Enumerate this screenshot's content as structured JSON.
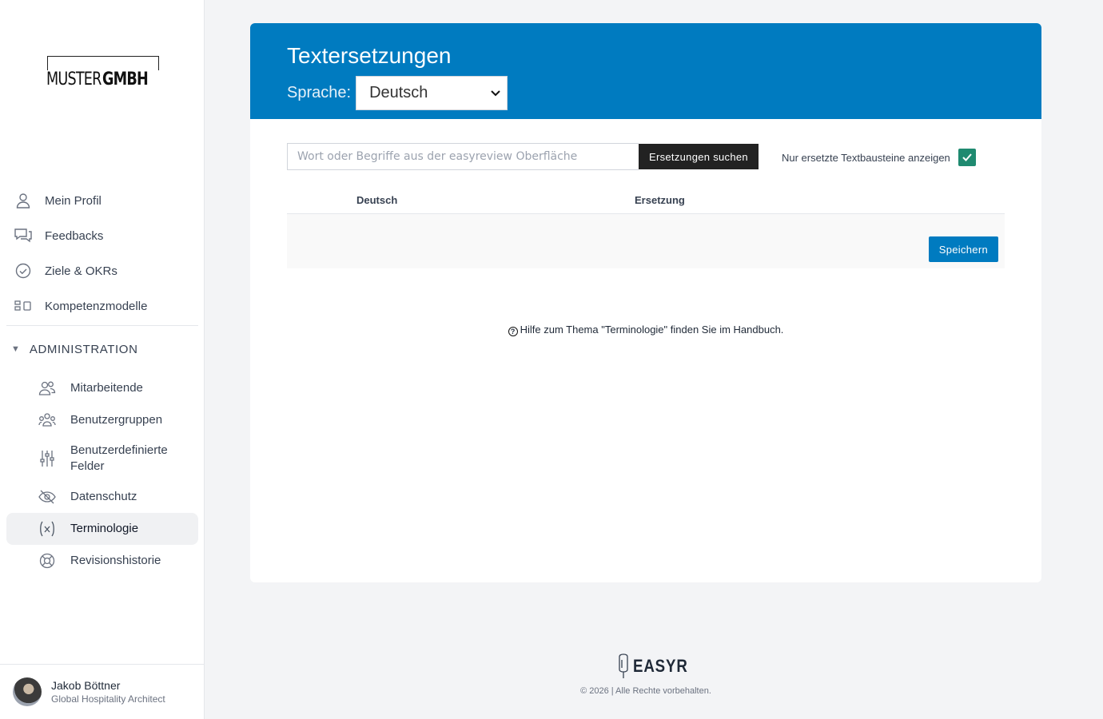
{
  "brand": {
    "logo_light": "MUSTER",
    "logo_bold": "GMBH"
  },
  "sidebar": {
    "items": [
      {
        "label": "Mein Profil",
        "icon": "user-icon"
      },
      {
        "label": "Feedbacks",
        "icon": "chat-icon"
      },
      {
        "label": "Ziele & OKRs",
        "icon": "check-circle-icon"
      },
      {
        "label": "Kompetenzmodelle",
        "icon": "model-icon"
      }
    ],
    "section": {
      "label": "ADMINISTRATION",
      "items": [
        {
          "label": "Mitarbeitende",
          "icon": "users-icon"
        },
        {
          "label": "Benutzergruppen",
          "icon": "group-icon"
        },
        {
          "label": "Benutzerdefinierte Felder",
          "icon": "sliders-icon"
        },
        {
          "label": "Datenschutz",
          "icon": "eye-off-icon"
        },
        {
          "label": "Terminologie",
          "icon": "variable-icon",
          "active": true
        },
        {
          "label": "Revisionshistorie",
          "icon": "lifebuoy-icon"
        }
      ]
    }
  },
  "user": {
    "name": "Jakob Böttner",
    "role": "Global Hospitality Architect"
  },
  "main": {
    "title": "Textersetzungen",
    "language_label": "Sprache:",
    "language_value": "Deutsch",
    "search_placeholder": "Wort oder Begriffe aus der easyreview Oberfläche",
    "search_button": "Ersetzungen suchen",
    "filter_label": "Nur ersetzte Textbausteine anzeigen",
    "filter_checked": true,
    "columns": [
      "Deutsch",
      "Ersetzung"
    ],
    "save_button": "Speichern",
    "help_text": "Hilfe zum Thema \"Terminologie\" finden Sie im Handbuch."
  },
  "footer": {
    "brand": "EASYR",
    "copyright": "© 2026 | Alle Rechte vorbehalten."
  },
  "colors": {
    "primary": "#007bc0",
    "checkbox": "#1f8a70",
    "dark_button": "#222222"
  }
}
